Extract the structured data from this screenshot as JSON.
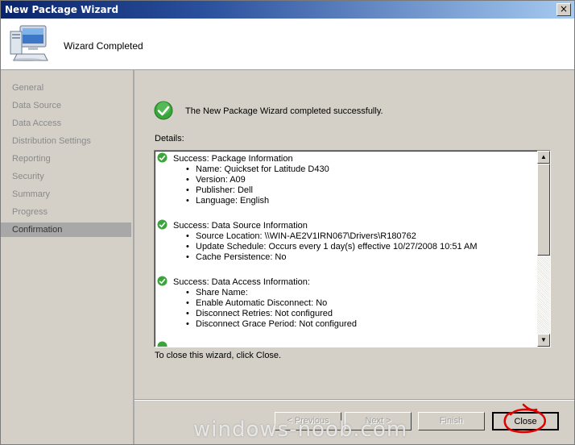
{
  "window": {
    "title": "New Package Wizard",
    "close_glyph": "×"
  },
  "header": {
    "title": "Wizard Completed",
    "icon": "computer-icon"
  },
  "nav": {
    "items": [
      {
        "label": "General"
      },
      {
        "label": "Data Source"
      },
      {
        "label": "Data Access"
      },
      {
        "label": "Distribution Settings"
      },
      {
        "label": "Reporting"
      },
      {
        "label": "Security"
      },
      {
        "label": "Summary"
      },
      {
        "label": "Progress"
      },
      {
        "label": "Confirmation"
      }
    ],
    "active": "Confirmation"
  },
  "main": {
    "success_message": "The New Package Wizard completed successfully.",
    "details_label": "Details:",
    "sections": [
      {
        "title": "Success: Package Information",
        "lines": [
          "Name: Quickset for Latitude D430",
          "Version: A09",
          "Publisher: Dell",
          "Language: English"
        ]
      },
      {
        "title": "Success: Data Source Information",
        "lines": [
          "Source Location: \\\\WIN-AE2V1IRN067\\Drivers\\R180762",
          "Update Schedule: Occurs every 1 day(s) effective 10/27/2008 10:51 AM",
          "Cache Persistence: No"
        ]
      },
      {
        "title": "Success: Data Access Information:",
        "lines": [
          "Share Name:",
          "Enable Automatic Disconnect: No",
          "Disconnect Retries: Not configured",
          "Disconnect Grace Period: Not configured"
        ]
      }
    ],
    "close_hint": "To close this wizard, click Close."
  },
  "buttons": {
    "previous": "< Previous",
    "next": "Next >",
    "finish": "Finish",
    "close": "Close"
  },
  "watermark": "windows-noob.com",
  "colors": {
    "title_start": "#0a246a",
    "title_end": "#a6caf0",
    "success_green": "#3aa53a",
    "annotation_red": "#e00000"
  }
}
